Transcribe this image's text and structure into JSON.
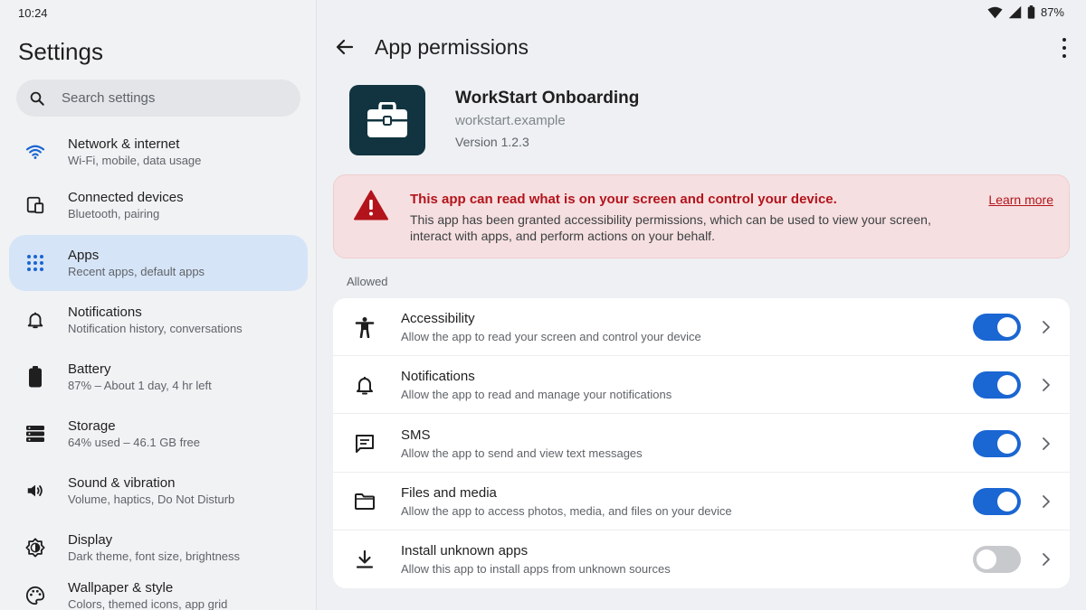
{
  "status": {
    "time": "10:24",
    "battery": "87%"
  },
  "sidebar": {
    "title": "Settings",
    "search_placeholder": "Search settings",
    "items": [
      {
        "label": "Network & internet",
        "sub": "Wi-Fi, mobile, data usage",
        "icon": "wifi-icon"
      },
      {
        "label": "Connected devices",
        "sub": "Bluetooth, pairing",
        "icon": "devices-icon"
      },
      {
        "label": "Apps",
        "sub": "Recent apps, default apps",
        "icon": "apps-grid-icon",
        "active": true
      },
      {
        "label": "Notifications",
        "sub": "Notification history, conversations",
        "icon": "bell-icon"
      },
      {
        "label": "Battery",
        "sub": "87% – About 1 day, 4 hr left",
        "icon": "battery-icon"
      },
      {
        "label": "Storage",
        "sub": "64% used – 46.1 GB free",
        "icon": "storage-icon"
      },
      {
        "label": "Sound & vibration",
        "sub": "Volume, haptics, Do Not Disturb",
        "icon": "speaker-icon"
      },
      {
        "label": "Display",
        "sub": "Dark theme, font size, brightness",
        "icon": "brightness-icon"
      },
      {
        "label": "Wallpaper & style",
        "sub": "Colors, themed icons, app grid",
        "icon": "palette-icon"
      }
    ]
  },
  "header": {
    "title": "App permissions"
  },
  "app": {
    "name": "WorkStart Onboarding",
    "package": "workstart.example",
    "version": "Version 1.2.3",
    "icon": "briefcase-icon"
  },
  "warning": {
    "title": "This app can read what is on your screen and control your device.",
    "body": "This app has been granted accessibility permissions, which can be used to view your screen, interact with apps, and perform actions on your behalf.",
    "link": "Learn more",
    "color": "#b3141c"
  },
  "permissions": {
    "section_label": "Allowed",
    "items": [
      {
        "label": "Accessibility",
        "sub": "Allow the app to read your screen and control your device",
        "icon": "accessibility-icon",
        "enabled": true
      },
      {
        "label": "Notifications",
        "sub": "Allow the app to read and manage your notifications",
        "icon": "bell-icon",
        "enabled": true
      },
      {
        "label": "SMS",
        "sub": "Allow the app to send and view text messages",
        "icon": "message-icon",
        "enabled": true
      },
      {
        "label": "Files and media",
        "sub": "Allow the app to access photos, media, and files on your device",
        "icon": "folder-icon",
        "enabled": true
      },
      {
        "label": "Install unknown apps",
        "sub": "Allow this app to install apps from unknown sources",
        "icon": "download-icon",
        "enabled": false
      }
    ]
  },
  "colors": {
    "accent": "#1a66d2",
    "active_nav": "#d6e4f7",
    "app_icon_bg": "#113440"
  }
}
